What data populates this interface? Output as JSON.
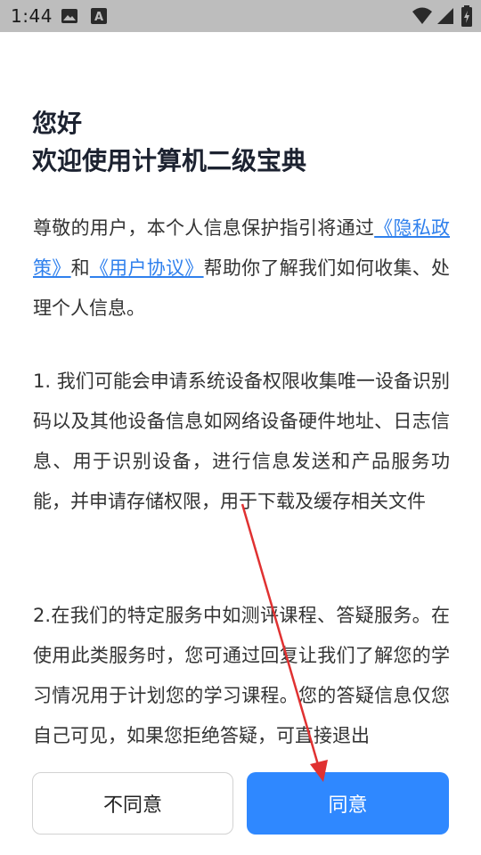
{
  "status_bar": {
    "time": "1:44",
    "icons": [
      "image-icon",
      "text-a-icon",
      "wifi-icon",
      "signal-icon",
      "battery-icon"
    ]
  },
  "dialog": {
    "greeting": "您好",
    "title": "欢迎使用计算机二级宝典",
    "intro": {
      "before": "尊敬的用户，本个人信息保护指引将通过",
      "privacy_link": "《隐私政策》",
      "and": "和",
      "agreement_link": "《用户协议》",
      "after": "帮助你了解我们如何收集、处理个人信息。"
    },
    "item1": "1. 我们可能会申请系统设备权限收集唯一设备识别码以及其他设备信息如网络设备硬件地址、日志信息、用于识别设备，进行信息发送和产品服务功能，并申请存储权限，用于下载及缓存相关文件",
    "item2": "2.在我们的特定服务中如测评课程、答疑服务。在使用此类服务时，您可通过回复让我们了解您的学习情况用于计划您的学习课程。您的答疑信息仅您自己可见，如果您拒绝答疑，可直接退出"
  },
  "buttons": {
    "disagree": "不同意",
    "agree": "同意"
  },
  "colors": {
    "accent": "#2f88ff",
    "link": "#2f80ed",
    "annotation_arrow": "#e03131",
    "status_bar": "#bdbdbd"
  }
}
